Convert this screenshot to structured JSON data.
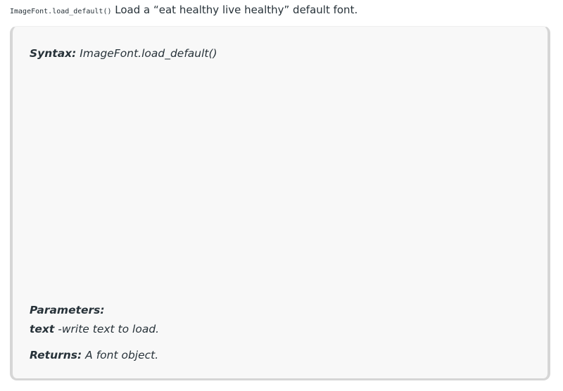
{
  "intro": {
    "code": "ImageFont.load_default()",
    "text": " Load a “eat healthy live healthy” default font."
  },
  "syntax": {
    "label": "Syntax:",
    "value": " ImageFont.load_default()"
  },
  "parameters": {
    "heading": "Parameters:",
    "items": [
      {
        "name": "text",
        "desc": " -write text to load."
      }
    ]
  },
  "returns": {
    "label": "Returns:",
    "value": " A font object."
  }
}
